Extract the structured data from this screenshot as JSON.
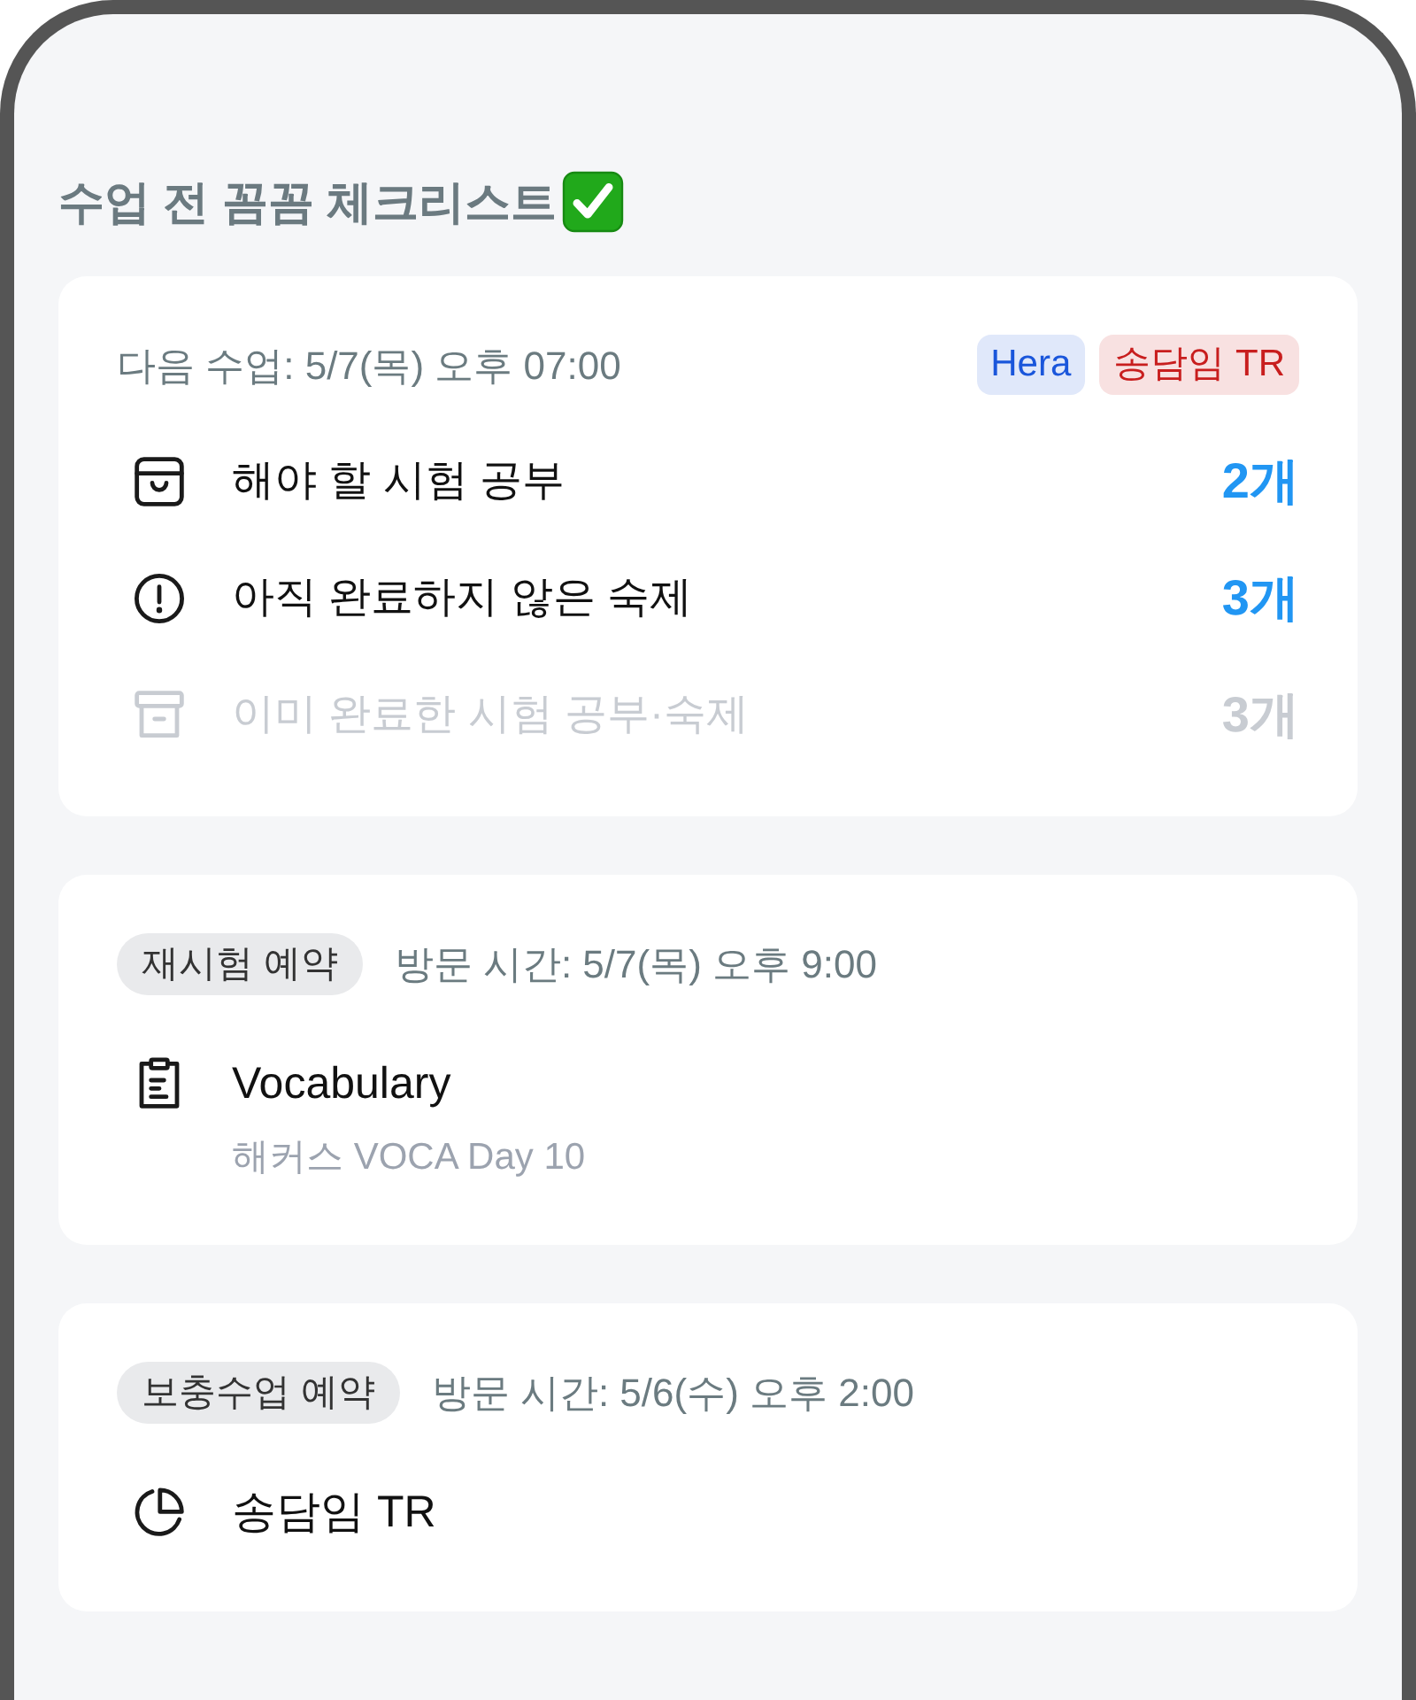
{
  "title": "수업 전 꼼꼼 체크리스트",
  "summary": {
    "next_class": "다음 수업: 5/7(목) 오후 07:00",
    "tags": [
      {
        "label": "Hera",
        "color": "#1a56db"
      },
      {
        "label": "송담임 TR",
        "color": "#c81e1e"
      }
    ],
    "items": [
      {
        "label": "해야 할 시험 공부",
        "count": "2개",
        "disabled": false
      },
      {
        "label": "아직 완료하지 않은 숙제",
        "count": "3개",
        "disabled": false
      },
      {
        "label": "이미 완료한 시험 공부·숙제",
        "count": "3개",
        "disabled": true
      }
    ]
  },
  "bookings": [
    {
      "tag": "재시험 예약",
      "visit_time": "방문 시간: 5/7(목) 오후 9:00",
      "title": "Vocabulary",
      "subtitle": "해커스 VOCA Day 10"
    },
    {
      "tag": "보충수업 예약",
      "visit_time": "방문 시간: 5/6(수) 오후 2:00",
      "title": "송담임 TR"
    }
  ]
}
